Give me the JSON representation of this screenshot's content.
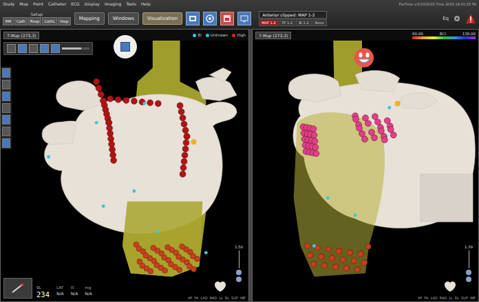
{
  "menu": [
    "Study",
    "Map",
    "Point",
    "Catheter",
    "ECG",
    "Display",
    "Imaging",
    "Tools",
    "Help"
  ],
  "status_text": "FileTime v.5/10/2015 Time 2015 14:31:15:56",
  "toolbar": {
    "group_label": "Setup",
    "small_buttons": [
      "RM",
      "Cath",
      "Resp",
      "CathL",
      "Stop"
    ],
    "buttons": [
      {
        "label": "Mapping",
        "selected": false
      },
      {
        "label": "Windows",
        "selected": false
      },
      {
        "label": "Visualization",
        "selected": true
      }
    ]
  },
  "map_status": {
    "label": "Anterior clipped: MAP 1-2",
    "tabs": [
      {
        "label": "MAP 1-2",
        "selected": true
      },
      {
        "label": "FF 1-2",
        "selected": false
      },
      {
        "label": "Bi 1-2",
        "selected": false
      },
      {
        "label": "None",
        "selected": false
      }
    ]
  },
  "top_right": {
    "label": "Eq"
  },
  "views": [
    {
      "title": "7-Map (273,3)",
      "slider": {
        "level": 0.7
      },
      "legend": [
        {
          "label": "Bi",
          "color": "#2ec4d6"
        },
        {
          "label": "Unknown",
          "color": "#2ec4d6"
        },
        {
          "label": "High",
          "color": "#e02020"
        }
      ],
      "lesion_color": "#b01414",
      "scale": "1.50",
      "orientation": [
        "AP",
        "PA",
        "LAO",
        "RAO",
        "LL",
        "RL",
        "SUP",
        "INF"
      ]
    },
    {
      "title": "7-Map (273,3)",
      "colorbar": {
        "min": "60.00",
        "max": "138.00",
        "label": "BCI"
      },
      "lesion_color": "#e0408a",
      "scale": "1.39",
      "orientation": [
        "AP",
        "PA",
        "LAO",
        "RAO",
        "LL",
        "RL",
        "SUP",
        "INF"
      ]
    }
  ],
  "readout": {
    "labels": [
      "BL",
      "LAT",
      "IS",
      "mg"
    ],
    "values": [
      "234",
      "N/A",
      "N/A",
      "N/A"
    ]
  }
}
